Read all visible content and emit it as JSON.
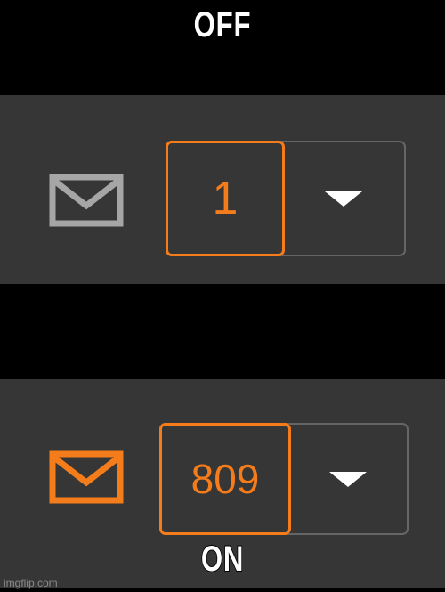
{
  "captions": {
    "top": "OFF",
    "bottom": "ON"
  },
  "off_state": {
    "mail_icon": "envelope-icon",
    "mail_icon_color": "#a6a6a6",
    "count": "1",
    "dropdown_icon": "caret-down-icon"
  },
  "on_state": {
    "mail_icon": "envelope-icon",
    "mail_icon_color": "#f57c1b",
    "count": "809",
    "dropdown_icon": "caret-down-icon"
  },
  "colors": {
    "background": "#000000",
    "panel": "#363636",
    "accent": "#f57c1b",
    "border": "#666666"
  },
  "watermark": "imgflip.com"
}
